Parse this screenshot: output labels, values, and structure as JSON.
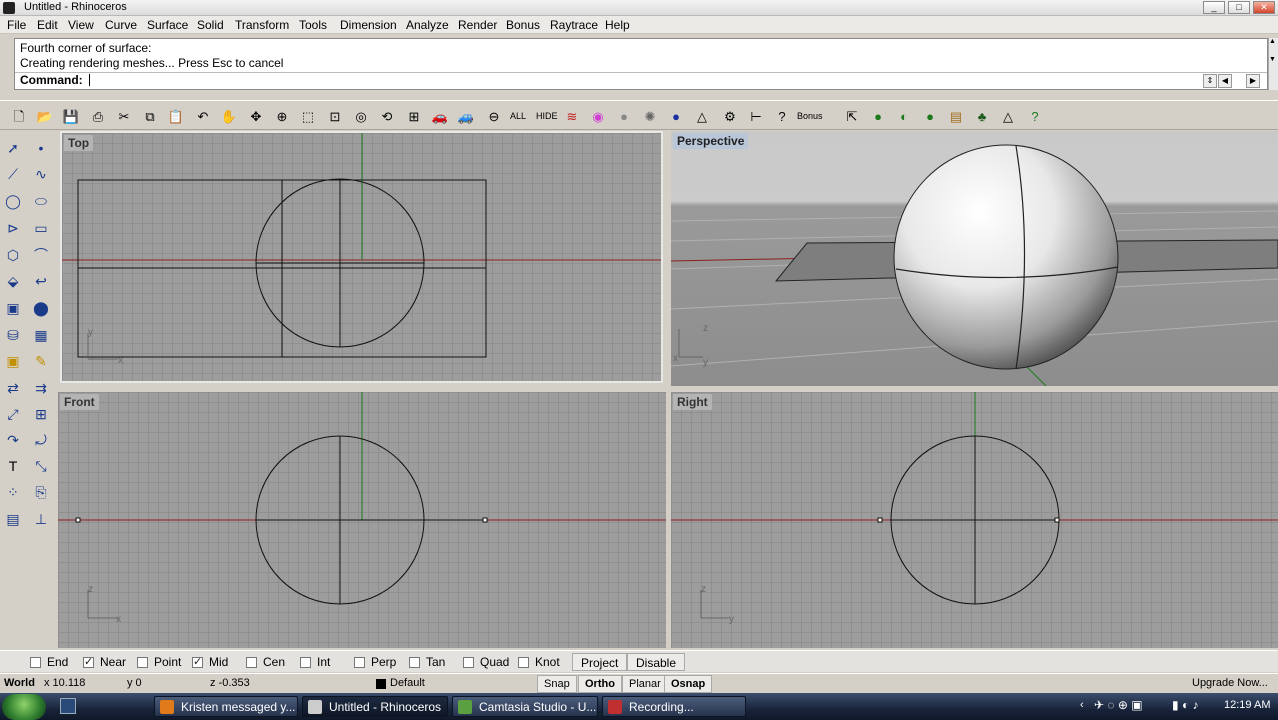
{
  "window": {
    "title": "Untitled - Rhinoceros",
    "btn_min": "_",
    "btn_max": "□",
    "btn_close": "✕"
  },
  "menu": [
    "File",
    "Edit",
    "View",
    "Curve",
    "Surface",
    "Solid",
    "Transform",
    "Tools",
    "Dimension",
    "Analyze",
    "Render",
    "Bonus",
    "Raytrace",
    "Help"
  ],
  "command": {
    "history": [
      "Fourth corner of surface:",
      "Creating rendering meshes... Press Esc to cancel"
    ],
    "prompt": "Command:",
    "value": ""
  },
  "toolbar": {
    "all_label": "ALL",
    "hide_label": "HIDE",
    "bonus_label": "Bonus"
  },
  "viewports": {
    "top": "Top",
    "perspective": "Perspective",
    "front": "Front",
    "right": "Right"
  },
  "axes": {
    "x": "x",
    "y": "y",
    "z": "z"
  },
  "osnap": {
    "items": [
      {
        "label": "End",
        "checked": false
      },
      {
        "label": "Near",
        "checked": true
      },
      {
        "label": "Point",
        "checked": false
      },
      {
        "label": "Mid",
        "checked": true
      },
      {
        "label": "Cen",
        "checked": false
      },
      {
        "label": "Int",
        "checked": false
      },
      {
        "label": "Perp",
        "checked": false
      },
      {
        "label": "Tan",
        "checked": false
      },
      {
        "label": "Quad",
        "checked": false
      },
      {
        "label": "Knot",
        "checked": false
      }
    ],
    "project": "Project",
    "disable": "Disable"
  },
  "status": {
    "cplane": "World",
    "x": "x 10.118",
    "y": "y 0",
    "z": "z -0.353",
    "layer": "Default",
    "snap": "Snap",
    "ortho": "Ortho",
    "planar": "Planar",
    "osnap": "Osnap",
    "upgrade": "Upgrade Now..."
  },
  "taskbar": {
    "tasks": [
      "Kristen messaged y...",
      "Untitled - Rhinoceros",
      "Camtasia Studio - U...",
      "Recording..."
    ],
    "time": "12:19 AM"
  },
  "colors": {
    "viewport_bg": "#9d9d9d",
    "grid": "#8f8f8f",
    "x_axis": "#8b1e1e",
    "y_axis": "#1c7a1c",
    "curve": "#111111"
  }
}
